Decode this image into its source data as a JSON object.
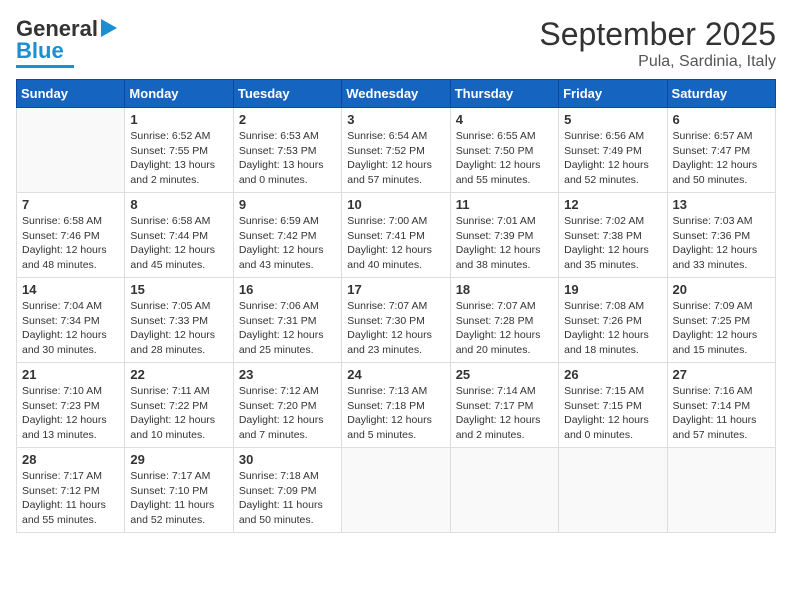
{
  "logo": {
    "text1": "General",
    "text2": "Blue"
  },
  "title": "September 2025",
  "location": "Pula, Sardinia, Italy",
  "days_of_week": [
    "Sunday",
    "Monday",
    "Tuesday",
    "Wednesday",
    "Thursday",
    "Friday",
    "Saturday"
  ],
  "weeks": [
    [
      {
        "day": "",
        "info": ""
      },
      {
        "day": "1",
        "info": "Sunrise: 6:52 AM\nSunset: 7:55 PM\nDaylight: 13 hours\nand 2 minutes."
      },
      {
        "day": "2",
        "info": "Sunrise: 6:53 AM\nSunset: 7:53 PM\nDaylight: 13 hours\nand 0 minutes."
      },
      {
        "day": "3",
        "info": "Sunrise: 6:54 AM\nSunset: 7:52 PM\nDaylight: 12 hours\nand 57 minutes."
      },
      {
        "day": "4",
        "info": "Sunrise: 6:55 AM\nSunset: 7:50 PM\nDaylight: 12 hours\nand 55 minutes."
      },
      {
        "day": "5",
        "info": "Sunrise: 6:56 AM\nSunset: 7:49 PM\nDaylight: 12 hours\nand 52 minutes."
      },
      {
        "day": "6",
        "info": "Sunrise: 6:57 AM\nSunset: 7:47 PM\nDaylight: 12 hours\nand 50 minutes."
      }
    ],
    [
      {
        "day": "7",
        "info": "Sunrise: 6:58 AM\nSunset: 7:46 PM\nDaylight: 12 hours\nand 48 minutes."
      },
      {
        "day": "8",
        "info": "Sunrise: 6:58 AM\nSunset: 7:44 PM\nDaylight: 12 hours\nand 45 minutes."
      },
      {
        "day": "9",
        "info": "Sunrise: 6:59 AM\nSunset: 7:42 PM\nDaylight: 12 hours\nand 43 minutes."
      },
      {
        "day": "10",
        "info": "Sunrise: 7:00 AM\nSunset: 7:41 PM\nDaylight: 12 hours\nand 40 minutes."
      },
      {
        "day": "11",
        "info": "Sunrise: 7:01 AM\nSunset: 7:39 PM\nDaylight: 12 hours\nand 38 minutes."
      },
      {
        "day": "12",
        "info": "Sunrise: 7:02 AM\nSunset: 7:38 PM\nDaylight: 12 hours\nand 35 minutes."
      },
      {
        "day": "13",
        "info": "Sunrise: 7:03 AM\nSunset: 7:36 PM\nDaylight: 12 hours\nand 33 minutes."
      }
    ],
    [
      {
        "day": "14",
        "info": "Sunrise: 7:04 AM\nSunset: 7:34 PM\nDaylight: 12 hours\nand 30 minutes."
      },
      {
        "day": "15",
        "info": "Sunrise: 7:05 AM\nSunset: 7:33 PM\nDaylight: 12 hours\nand 28 minutes."
      },
      {
        "day": "16",
        "info": "Sunrise: 7:06 AM\nSunset: 7:31 PM\nDaylight: 12 hours\nand 25 minutes."
      },
      {
        "day": "17",
        "info": "Sunrise: 7:07 AM\nSunset: 7:30 PM\nDaylight: 12 hours\nand 23 minutes."
      },
      {
        "day": "18",
        "info": "Sunrise: 7:07 AM\nSunset: 7:28 PM\nDaylight: 12 hours\nand 20 minutes."
      },
      {
        "day": "19",
        "info": "Sunrise: 7:08 AM\nSunset: 7:26 PM\nDaylight: 12 hours\nand 18 minutes."
      },
      {
        "day": "20",
        "info": "Sunrise: 7:09 AM\nSunset: 7:25 PM\nDaylight: 12 hours\nand 15 minutes."
      }
    ],
    [
      {
        "day": "21",
        "info": "Sunrise: 7:10 AM\nSunset: 7:23 PM\nDaylight: 12 hours\nand 13 minutes."
      },
      {
        "day": "22",
        "info": "Sunrise: 7:11 AM\nSunset: 7:22 PM\nDaylight: 12 hours\nand 10 minutes."
      },
      {
        "day": "23",
        "info": "Sunrise: 7:12 AM\nSunset: 7:20 PM\nDaylight: 12 hours\nand 7 minutes."
      },
      {
        "day": "24",
        "info": "Sunrise: 7:13 AM\nSunset: 7:18 PM\nDaylight: 12 hours\nand 5 minutes."
      },
      {
        "day": "25",
        "info": "Sunrise: 7:14 AM\nSunset: 7:17 PM\nDaylight: 12 hours\nand 2 minutes."
      },
      {
        "day": "26",
        "info": "Sunrise: 7:15 AM\nSunset: 7:15 PM\nDaylight: 12 hours\nand 0 minutes."
      },
      {
        "day": "27",
        "info": "Sunrise: 7:16 AM\nSunset: 7:14 PM\nDaylight: 11 hours\nand 57 minutes."
      }
    ],
    [
      {
        "day": "28",
        "info": "Sunrise: 7:17 AM\nSunset: 7:12 PM\nDaylight: 11 hours\nand 55 minutes."
      },
      {
        "day": "29",
        "info": "Sunrise: 7:17 AM\nSunset: 7:10 PM\nDaylight: 11 hours\nand 52 minutes."
      },
      {
        "day": "30",
        "info": "Sunrise: 7:18 AM\nSunset: 7:09 PM\nDaylight: 11 hours\nand 50 minutes."
      },
      {
        "day": "",
        "info": ""
      },
      {
        "day": "",
        "info": ""
      },
      {
        "day": "",
        "info": ""
      },
      {
        "day": "",
        "info": ""
      }
    ]
  ]
}
